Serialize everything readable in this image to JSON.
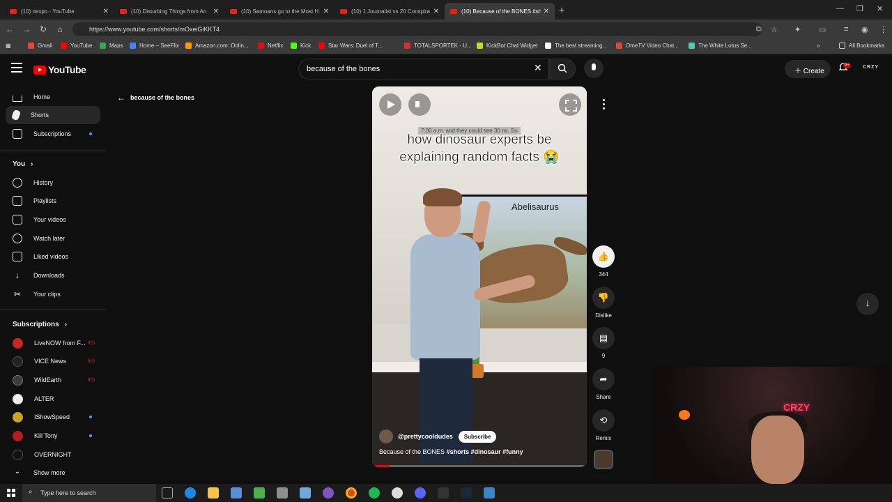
{
  "browser": {
    "tabs": [
      {
        "title": "(10) nexpo - YouTube",
        "active": false
      },
      {
        "title": "(10) Disturbing Things from An",
        "active": false
      },
      {
        "title": "(10) Samoans go to the Most H",
        "active": false
      },
      {
        "title": "(10) 1 Journalist vs 20 Conspira",
        "active": false
      },
      {
        "title": "(10) Because of the BONES #sh",
        "active": true
      }
    ],
    "new_tab": "+",
    "url": "https://www.youtube.com/shorts/mOxeiGiKKT4",
    "bookmarks": [
      {
        "label": "Gmail",
        "color": "#ea4335"
      },
      {
        "label": "YouTube",
        "color": "#ff0000"
      },
      {
        "label": "Maps",
        "color": "#34a853"
      },
      {
        "label": "Home – SeeFlix",
        "color": "#4285f4"
      },
      {
        "label": "Amazon.com: Onlin...",
        "color": "#ff9900"
      },
      {
        "label": "Netflix",
        "color": "#e50914"
      },
      {
        "label": "Kick",
        "color": "#53fc18"
      },
      {
        "label": "Star Wars: Duel of T...",
        "color": "#ff0000"
      },
      {
        "label": "TOTALSPORTEK - U...",
        "color": "#d32f2f"
      },
      {
        "label": "KickBot Chat Widget",
        "color": "#b6e32a"
      },
      {
        "label": "The best streaming...",
        "color": "#ffffff"
      },
      {
        "label": "OmeTV Video Chat...",
        "color": "#d64a3a"
      },
      {
        "label": "The White Lotus Se...",
        "color": "#57c7b8"
      }
    ],
    "all_bookmarks": "All Bookmarks"
  },
  "header": {
    "logo": "YouTube",
    "search_value": "because of the bones",
    "create_label": "Create",
    "notif_badge": "9+",
    "channel_tag": "CRZY"
  },
  "sidebar": {
    "main": [
      {
        "label": "Home",
        "icon": "home-icon"
      },
      {
        "label": "Shorts",
        "icon": "shorts-icon",
        "active": true
      },
      {
        "label": "Subscriptions",
        "icon": "subscriptions-icon",
        "dot": true
      }
    ],
    "you_heading": "You",
    "you": [
      {
        "label": "History",
        "icon": "history-icon"
      },
      {
        "label": "Playlists",
        "icon": "playlists-icon"
      },
      {
        "label": "Your videos",
        "icon": "your-videos-icon"
      },
      {
        "label": "Watch later",
        "icon": "watch-later-icon"
      },
      {
        "label": "Liked videos",
        "icon": "liked-videos-icon"
      },
      {
        "label": "Downloads",
        "icon": "downloads-icon"
      },
      {
        "label": "Your clips",
        "icon": "clips-icon"
      }
    ],
    "subs_heading": "Subscriptions",
    "subs": [
      {
        "label": "LiveNOW from F...",
        "color": "#c62828",
        "live": true
      },
      {
        "label": "VICE News",
        "color": "#222222",
        "live": true
      },
      {
        "label": "WildEarth",
        "color": "#3c3c3c",
        "live": true
      },
      {
        "label": "ALTER",
        "color": "#eeeeee",
        "live": false
      },
      {
        "label": "IShowSpeed",
        "color": "#c9a227",
        "dot": true
      },
      {
        "label": "Kill Tony",
        "color": "#b71c1c",
        "dot": true
      },
      {
        "label": "OVERNIGHT",
        "color": "#111111"
      }
    ],
    "show_more": "Show more"
  },
  "back_label": "because of the bones",
  "video": {
    "small_caption": "7:00 a.m. and they could see 30 mi. So",
    "overlay_line1": "how dinosaur experts be",
    "overlay_line2": "explaining random facts 😭",
    "tv_label": "Abelisaurus",
    "channel": "@prettycooldudes",
    "subscribe": "Subscribe",
    "title": "Because of the BONES",
    "tags": "#shorts #dinosaur #funny",
    "progress": 0.08
  },
  "actions": {
    "like_count": "344",
    "dislike": "Dislike",
    "comments": "9",
    "share": "Share",
    "remix": "Remix"
  },
  "webcam": {
    "neon": "CRZY"
  },
  "taskbar": {
    "search_placeholder": "Type here to search"
  }
}
